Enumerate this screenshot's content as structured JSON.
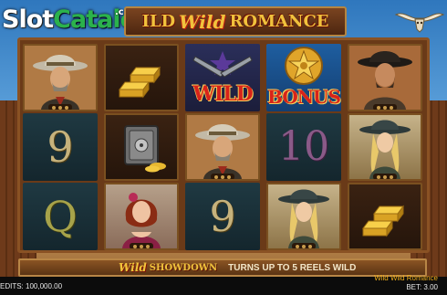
{
  "logo": {
    "slot": "Slot",
    "catalog": "Catalog",
    "com": ".com"
  },
  "title": {
    "part1": "ILD",
    "part2": "Wild",
    "part3": "ROMANCE"
  },
  "reels": [
    [
      "cowboy-sheriff",
      "nine",
      "q"
    ],
    [
      "gold-bars",
      "safe",
      "saloon-lady"
    ],
    [
      "wild-guns",
      "cowboy-sheriff",
      "nine"
    ],
    [
      "bonus-badge",
      "ten",
      "cowgirl"
    ],
    [
      "bandit",
      "cowgirl",
      "gold-bars"
    ]
  ],
  "symbols": {
    "nine": "9",
    "ten": "10",
    "q": "Q",
    "wild": "WILD",
    "bonus": "BONUS"
  },
  "showdown": {
    "wild": "Wild",
    "showdown": "SHOWDOWN",
    "message": "TURNS UP TO 5 REELS WILD"
  },
  "status": {
    "credits": "EDITS:  100,000.00",
    "game_name": "Wild Wild Romance",
    "bet": "BET: 3.00"
  },
  "colors": {
    "title_gold": "#f0c23c",
    "wild_red": "#d8231a",
    "status_game": "#f2b01c"
  }
}
